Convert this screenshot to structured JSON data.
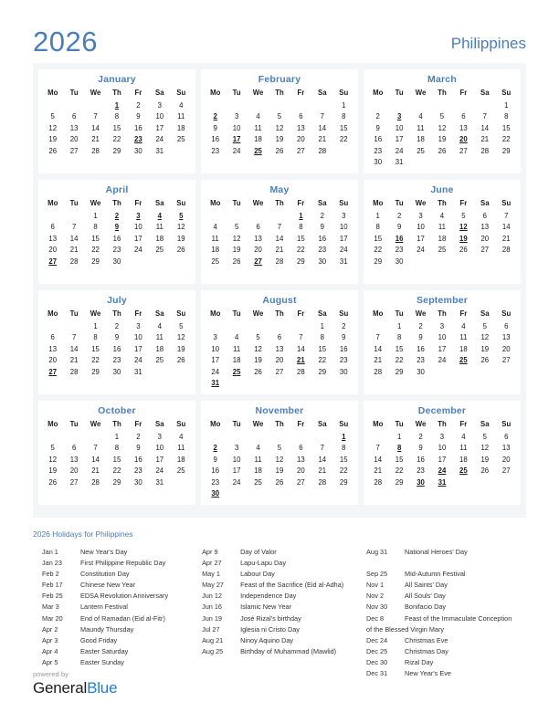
{
  "header": {
    "year": "2026",
    "country": "Philippines"
  },
  "months": [
    {
      "name": "January",
      "weekdays": [
        "Mo",
        "Tu",
        "We",
        "Th",
        "Fr",
        "Sa",
        "Su"
      ],
      "weeks": [
        [
          "",
          "",
          "",
          "1",
          "2",
          "3",
          "4"
        ],
        [
          "5",
          "6",
          "7",
          "8",
          "9",
          "10",
          "11"
        ],
        [
          "12",
          "13",
          "14",
          "15",
          "16",
          "17",
          "18"
        ],
        [
          "19",
          "20",
          "21",
          "22",
          "23",
          "24",
          "25"
        ],
        [
          "26",
          "27",
          "28",
          "29",
          "30",
          "31",
          ""
        ],
        [
          "",
          "",
          "",
          "",
          "",
          "",
          ""
        ]
      ],
      "holidays": [
        "1",
        "23"
      ]
    },
    {
      "name": "February",
      "weekdays": [
        "Mo",
        "Tu",
        "We",
        "Th",
        "Fr",
        "Sa",
        "Su"
      ],
      "weeks": [
        [
          "",
          "",
          "",
          "",
          "",
          "",
          "1"
        ],
        [
          "2",
          "3",
          "4",
          "5",
          "6",
          "7",
          "8"
        ],
        [
          "9",
          "10",
          "11",
          "12",
          "13",
          "14",
          "15"
        ],
        [
          "16",
          "17",
          "18",
          "19",
          "20",
          "21",
          "22"
        ],
        [
          "23",
          "24",
          "25",
          "26",
          "27",
          "28",
          ""
        ],
        [
          "",
          "",
          "",
          "",
          "",
          "",
          ""
        ]
      ],
      "holidays": [
        "2",
        "17",
        "25"
      ]
    },
    {
      "name": "March",
      "weekdays": [
        "Mo",
        "Tu",
        "We",
        "Th",
        "Fr",
        "Sa",
        "Su"
      ],
      "weeks": [
        [
          "",
          "",
          "",
          "",
          "",
          "",
          "1"
        ],
        [
          "2",
          "3",
          "4",
          "5",
          "6",
          "7",
          "8"
        ],
        [
          "9",
          "10",
          "11",
          "12",
          "13",
          "14",
          "15"
        ],
        [
          "16",
          "17",
          "18",
          "19",
          "20",
          "21",
          "22"
        ],
        [
          "23",
          "24",
          "25",
          "26",
          "27",
          "28",
          "29"
        ],
        [
          "30",
          "31",
          "",
          "",
          "",
          "",
          ""
        ]
      ],
      "holidays": [
        "3",
        "20"
      ]
    },
    {
      "name": "April",
      "weekdays": [
        "Mo",
        "Tu",
        "We",
        "Th",
        "Fr",
        "Sa",
        "Su"
      ],
      "weeks": [
        [
          "",
          "",
          "1",
          "2",
          "3",
          "4",
          "5"
        ],
        [
          "6",
          "7",
          "8",
          "9",
          "10",
          "11",
          "12"
        ],
        [
          "13",
          "14",
          "15",
          "16",
          "17",
          "18",
          "19"
        ],
        [
          "20",
          "21",
          "22",
          "23",
          "24",
          "25",
          "26"
        ],
        [
          "27",
          "28",
          "29",
          "30",
          "",
          "",
          ""
        ],
        [
          "",
          "",
          "",
          "",
          "",
          "",
          ""
        ]
      ],
      "holidays": [
        "2",
        "3",
        "4",
        "5",
        "9",
        "27"
      ]
    },
    {
      "name": "May",
      "weekdays": [
        "Mo",
        "Tu",
        "We",
        "Th",
        "Fr",
        "Sa",
        "Su"
      ],
      "weeks": [
        [
          "",
          "",
          "",
          "",
          "1",
          "2",
          "3"
        ],
        [
          "4",
          "5",
          "6",
          "7",
          "8",
          "9",
          "10"
        ],
        [
          "11",
          "12",
          "13",
          "14",
          "15",
          "16",
          "17"
        ],
        [
          "18",
          "19",
          "20",
          "21",
          "22",
          "23",
          "24"
        ],
        [
          "25",
          "26",
          "27",
          "28",
          "29",
          "30",
          "31"
        ],
        [
          "",
          "",
          "",
          "",
          "",
          "",
          ""
        ]
      ],
      "holidays": [
        "1",
        "27"
      ]
    },
    {
      "name": "June",
      "weekdays": [
        "Mo",
        "Tu",
        "We",
        "Th",
        "Fr",
        "Sa",
        "Su"
      ],
      "weeks": [
        [
          "1",
          "2",
          "3",
          "4",
          "5",
          "6",
          "7"
        ],
        [
          "8",
          "9",
          "10",
          "11",
          "12",
          "13",
          "14"
        ],
        [
          "15",
          "16",
          "17",
          "18",
          "19",
          "20",
          "21"
        ],
        [
          "22",
          "23",
          "24",
          "25",
          "26",
          "27",
          "28"
        ],
        [
          "29",
          "30",
          "",
          "",
          "",
          "",
          ""
        ],
        [
          "",
          "",
          "",
          "",
          "",
          "",
          ""
        ]
      ],
      "holidays": [
        "12",
        "16",
        "19"
      ]
    },
    {
      "name": "July",
      "weekdays": [
        "Mo",
        "Tu",
        "We",
        "Th",
        "Fr",
        "Sa",
        "Su"
      ],
      "weeks": [
        [
          "",
          "",
          "1",
          "2",
          "3",
          "4",
          "5"
        ],
        [
          "6",
          "7",
          "8",
          "9",
          "10",
          "11",
          "12"
        ],
        [
          "13",
          "14",
          "15",
          "16",
          "17",
          "18",
          "19"
        ],
        [
          "20",
          "21",
          "22",
          "23",
          "24",
          "25",
          "26"
        ],
        [
          "27",
          "28",
          "29",
          "30",
          "31",
          "",
          ""
        ],
        [
          "",
          "",
          "",
          "",
          "",
          "",
          ""
        ]
      ],
      "holidays": [
        "27"
      ]
    },
    {
      "name": "August",
      "weekdays": [
        "Mo",
        "Tu",
        "We",
        "Th",
        "Fr",
        "Sa",
        "Su"
      ],
      "weeks": [
        [
          "",
          "",
          "",
          "",
          "",
          "1",
          "2"
        ],
        [
          "3",
          "4",
          "5",
          "6",
          "7",
          "8",
          "9"
        ],
        [
          "10",
          "11",
          "12",
          "13",
          "14",
          "15",
          "16"
        ],
        [
          "17",
          "18",
          "19",
          "20",
          "21",
          "22",
          "23"
        ],
        [
          "24",
          "25",
          "26",
          "27",
          "28",
          "29",
          "30"
        ],
        [
          "31",
          "",
          "",
          "",
          "",
          "",
          ""
        ]
      ],
      "holidays": [
        "21",
        "25",
        "31"
      ]
    },
    {
      "name": "September",
      "weekdays": [
        "Mo",
        "Tu",
        "We",
        "Th",
        "Fr",
        "Sa",
        "Su"
      ],
      "weeks": [
        [
          "",
          "1",
          "2",
          "3",
          "4",
          "5",
          "6"
        ],
        [
          "7",
          "8",
          "9",
          "10",
          "11",
          "12",
          "13"
        ],
        [
          "14",
          "15",
          "16",
          "17",
          "18",
          "19",
          "20"
        ],
        [
          "21",
          "22",
          "23",
          "24",
          "25",
          "26",
          "27"
        ],
        [
          "28",
          "29",
          "30",
          "",
          "",
          "",
          ""
        ],
        [
          "",
          "",
          "",
          "",
          "",
          "",
          ""
        ]
      ],
      "holidays": [
        "25"
      ]
    },
    {
      "name": "October",
      "weekdays": [
        "Mo",
        "Tu",
        "We",
        "Th",
        "Fr",
        "Sa",
        "Su"
      ],
      "weeks": [
        [
          "",
          "",
          "",
          "1",
          "2",
          "3",
          "4"
        ],
        [
          "5",
          "6",
          "7",
          "8",
          "9",
          "10",
          "11"
        ],
        [
          "12",
          "13",
          "14",
          "15",
          "16",
          "17",
          "18"
        ],
        [
          "19",
          "20",
          "21",
          "22",
          "23",
          "24",
          "25"
        ],
        [
          "26",
          "27",
          "28",
          "29",
          "30",
          "31",
          ""
        ],
        [
          "",
          "",
          "",
          "",
          "",
          "",
          ""
        ]
      ],
      "holidays": []
    },
    {
      "name": "November",
      "weekdays": [
        "Mo",
        "Tu",
        "We",
        "Th",
        "Fr",
        "Sa",
        "Su"
      ],
      "weeks": [
        [
          "",
          "",
          "",
          "",
          "",
          "",
          "1"
        ],
        [
          "2",
          "3",
          "4",
          "5",
          "6",
          "7",
          "8"
        ],
        [
          "9",
          "10",
          "11",
          "12",
          "13",
          "14",
          "15"
        ],
        [
          "16",
          "17",
          "18",
          "19",
          "20",
          "21",
          "22"
        ],
        [
          "23",
          "24",
          "25",
          "26",
          "27",
          "28",
          "29"
        ],
        [
          "30",
          "",
          "",
          "",
          "",
          "",
          ""
        ]
      ],
      "holidays": [
        "1",
        "2",
        "30"
      ]
    },
    {
      "name": "December",
      "weekdays": [
        "Mo",
        "Tu",
        "We",
        "Th",
        "Fr",
        "Sa",
        "Su"
      ],
      "weeks": [
        [
          "",
          "1",
          "2",
          "3",
          "4",
          "5",
          "6"
        ],
        [
          "7",
          "8",
          "9",
          "10",
          "11",
          "12",
          "13"
        ],
        [
          "14",
          "15",
          "16",
          "17",
          "18",
          "19",
          "20"
        ],
        [
          "21",
          "22",
          "23",
          "24",
          "25",
          "26",
          "27"
        ],
        [
          "28",
          "29",
          "30",
          "31",
          "",
          "",
          ""
        ],
        [
          "",
          "",
          "",
          "",
          "",
          "",
          ""
        ]
      ],
      "holidays": [
        "8",
        "24",
        "25",
        "30",
        "31"
      ]
    }
  ],
  "holidays_section": {
    "title": "2026 Holidays for Philippines",
    "columns": [
      [
        {
          "date": "Jan 1",
          "name": "New Year's Day"
        },
        {
          "date": "Jan 23",
          "name": "First Philippine Republic Day"
        },
        {
          "date": "Feb 2",
          "name": "Constitution Day"
        },
        {
          "date": "Feb 17",
          "name": "Chinese New Year"
        },
        {
          "date": "Feb 25",
          "name": "EDSA Revolution Anniversary"
        },
        {
          "date": "Mar 3",
          "name": "Lantern Festival"
        },
        {
          "date": "Mar 20",
          "name": "End of Ramadan (Eid al-Fitr)"
        },
        {
          "date": "Apr 2",
          "name": "Maundy Thursday"
        },
        {
          "date": "Apr 3",
          "name": "Good Friday"
        },
        {
          "date": "Apr 4",
          "name": "Easter Saturday"
        },
        {
          "date": "Apr 5",
          "name": "Easter Sunday"
        }
      ],
      [
        {
          "date": "Apr 9",
          "name": "Day of Valor"
        },
        {
          "date": "Apr 27",
          "name": "Lapu-Lapu Day"
        },
        {
          "date": "May 1",
          "name": "Labour Day"
        },
        {
          "date": "May 27",
          "name": "Feast of the Sacrifice (Eid al-Adha)"
        },
        {
          "date": "Jun 12",
          "name": "Independence Day"
        },
        {
          "date": "Jun 16",
          "name": "Islamic New Year"
        },
        {
          "date": "Jun 19",
          "name": "José Rizal's birthday"
        },
        {
          "date": "Jul 27",
          "name": "Iglesia ni Cristo Day"
        },
        {
          "date": "Aug 21",
          "name": "Ninoy Aquino Day"
        },
        {
          "date": "Aug 25",
          "name": "Birthday of Muhammad (Mawlid)"
        }
      ],
      [
        {
          "date": "Aug 31",
          "name": "National Heroes' Day"
        },
        {
          "date": "Sep 25",
          "name": "Mid-Autumn Festival"
        },
        {
          "date": "Nov 1",
          "name": "All Saints' Day"
        },
        {
          "date": "Nov 2",
          "name": "All Souls' Day"
        },
        {
          "date": "Nov 30",
          "name": "Bonifacio Day"
        },
        {
          "date": "Dec 8",
          "name": "Feast of the Immaculate Conception"
        },
        {
          "date": "",
          "name": "of the Blessed Virgin Mary",
          "wrap": true
        },
        {
          "date": "Dec 24",
          "name": "Christmas Eve"
        },
        {
          "date": "Dec 25",
          "name": "Christmas Day"
        },
        {
          "date": "Dec 30",
          "name": "Rizal Day"
        },
        {
          "date": "Dec 31",
          "name": "New Year's Eve"
        }
      ]
    ]
  },
  "footer": {
    "powered_by": "powered by",
    "logo_first": "General",
    "logo_second": "Blue"
  },
  "colors": {
    "accent": "#4a7ebb",
    "holiday": "#e00000",
    "logo_blue": "#1f7fd0",
    "panel_bg": "#f4f5f7"
  }
}
